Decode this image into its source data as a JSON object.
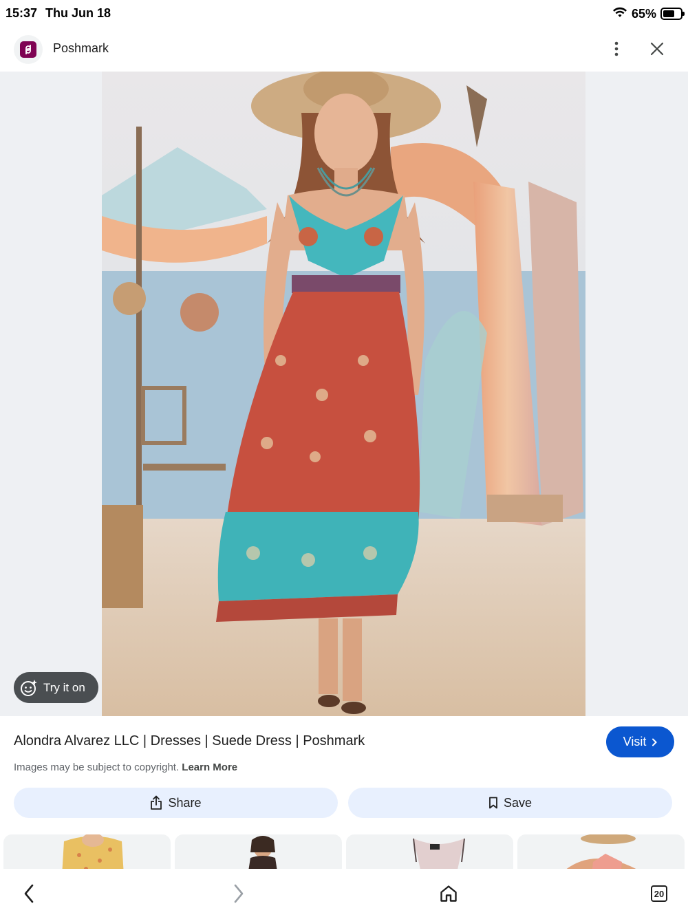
{
  "status_bar": {
    "time": "15:37",
    "date": "Thu Jun 18",
    "battery": "65%",
    "battery_level": 0.65
  },
  "header": {
    "site_name": "Poshmark",
    "menu_icon": "more-vert-icon",
    "close_icon": "close-icon"
  },
  "image": {
    "try_on_label": "Try it on"
  },
  "result": {
    "title": "Alondra Alvarez LLC | Dresses | Suede Dress | Poshmark",
    "visit_label": "Visit",
    "copyright_text": "Images may be subject to copyright.",
    "learn_more": "Learn More"
  },
  "actions": {
    "share_label": "Share",
    "save_label": "Save"
  },
  "bottom_nav": {
    "tab_count": "20"
  },
  "colors": {
    "accent": "#0b57d0",
    "action_bg": "#e8f0fe",
    "brand": "#7f0353"
  }
}
